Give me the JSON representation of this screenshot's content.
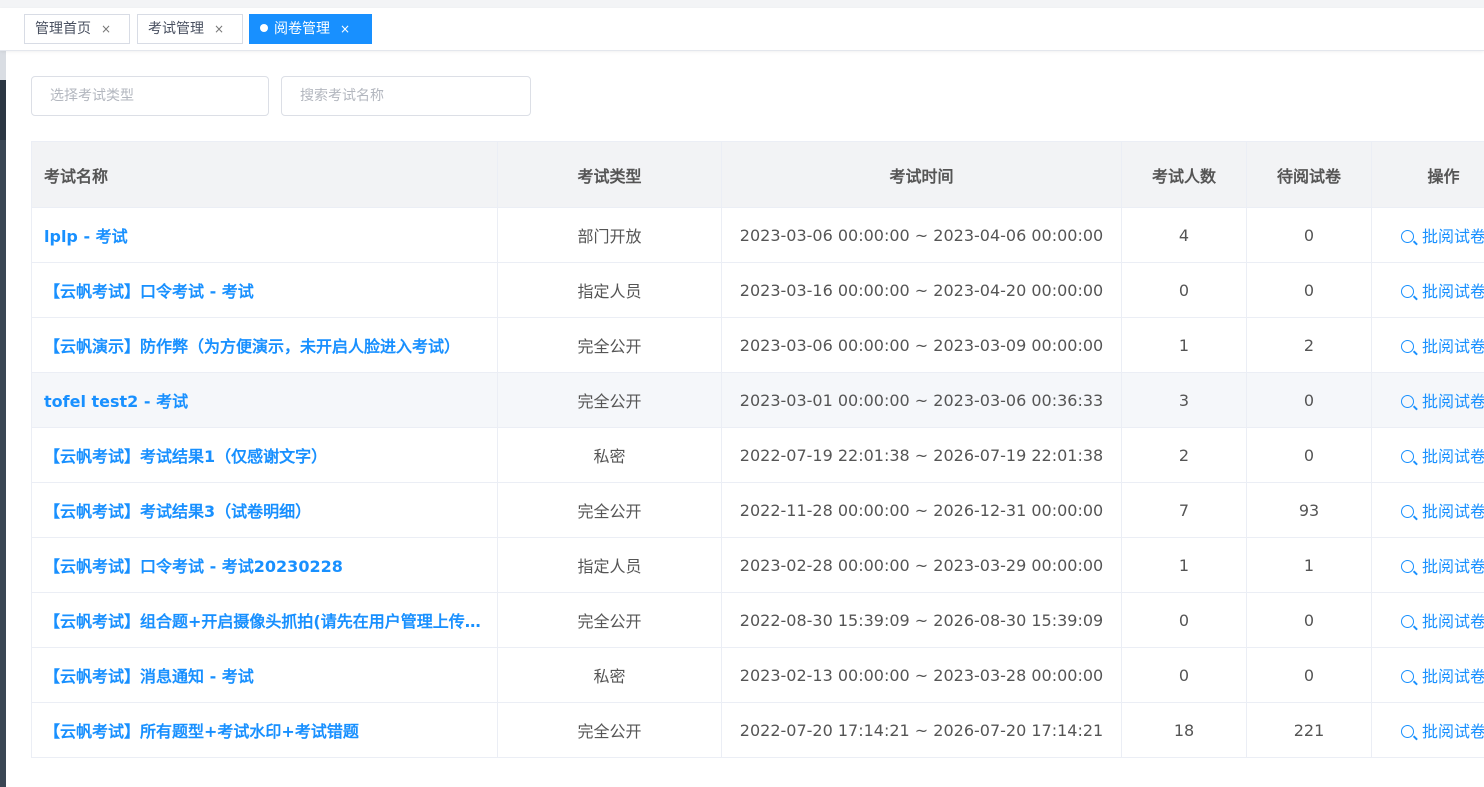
{
  "tags": [
    {
      "label": "管理首页",
      "close": "×",
      "active": false
    },
    {
      "label": "考试管理",
      "close": "×",
      "active": false
    },
    {
      "label": "阅卷管理",
      "close": "×",
      "active": true
    }
  ],
  "filters": {
    "exam_type_placeholder": "选择考试类型",
    "exam_name_placeholder": "搜索考试名称"
  },
  "table": {
    "columns": [
      "考试名称",
      "考试类型",
      "考试时间",
      "考试人数",
      "待阅试卷",
      "操作"
    ],
    "rows": [
      {
        "name": "lplp - 考试",
        "type": "部门开放",
        "time": "2023-03-06 00:00:00 ~ 2023-04-06 00:00:00",
        "count": "4",
        "pending": "0",
        "action": "批阅试卷"
      },
      {
        "name": "【云帆考试】口令考试 - 考试",
        "type": "指定人员",
        "time": "2023-03-16 00:00:00 ~ 2023-04-20 00:00:00",
        "count": "0",
        "pending": "0",
        "action": "批阅试卷"
      },
      {
        "name": "【云帆演示】防作弊（为方便演示，未开启人脸进入考试）",
        "type": "完全公开",
        "time": "2023-03-06 00:00:00 ~ 2023-03-09 00:00:00",
        "count": "1",
        "pending": "2",
        "action": "批阅试卷"
      },
      {
        "name": "tofel test2 - 考试",
        "type": "完全公开",
        "time": "2023-03-01 00:00:00 ~ 2023-03-06 00:36:33",
        "count": "3",
        "pending": "0",
        "action": "批阅试卷"
      },
      {
        "name": "【云帆考试】考试结果1（仅感谢文字）",
        "type": "私密",
        "time": "2022-07-19 22:01:38 ~ 2026-07-19 22:01:38",
        "count": "2",
        "pending": "0",
        "action": "批阅试卷"
      },
      {
        "name": "【云帆考试】考试结果3（试卷明细）",
        "type": "完全公开",
        "time": "2022-11-28 00:00:00 ~ 2026-12-31 00:00:00",
        "count": "7",
        "pending": "93",
        "action": "批阅试卷"
      },
      {
        "name": "【云帆考试】口令考试 - 考试20230228",
        "type": "指定人员",
        "time": "2023-02-28 00:00:00 ~ 2023-03-29 00:00:00",
        "count": "1",
        "pending": "1",
        "action": "批阅试卷"
      },
      {
        "name": "【云帆考试】组合题+开启摄像头抓拍(请先在用户管理上传人脸)",
        "type": "完全公开",
        "time": "2022-08-30 15:39:09 ~ 2026-08-30 15:39:09",
        "count": "0",
        "pending": "0",
        "action": "批阅试卷"
      },
      {
        "name": "【云帆考试】消息通知 - 考试",
        "type": "私密",
        "time": "2023-02-13 00:00:00 ~ 2023-03-28 00:00:00",
        "count": "0",
        "pending": "0",
        "action": "批阅试卷"
      },
      {
        "name": "【云帆考试】所有题型+考试水印+考试错题",
        "type": "完全公开",
        "time": "2022-07-20 17:14:21 ~ 2026-07-20 17:14:21",
        "count": "18",
        "pending": "221",
        "action": "批阅试卷"
      }
    ]
  },
  "colors": {
    "accent": "#1890ff",
    "header_bg": "#f2f3f5",
    "border": "#ebeef5"
  }
}
